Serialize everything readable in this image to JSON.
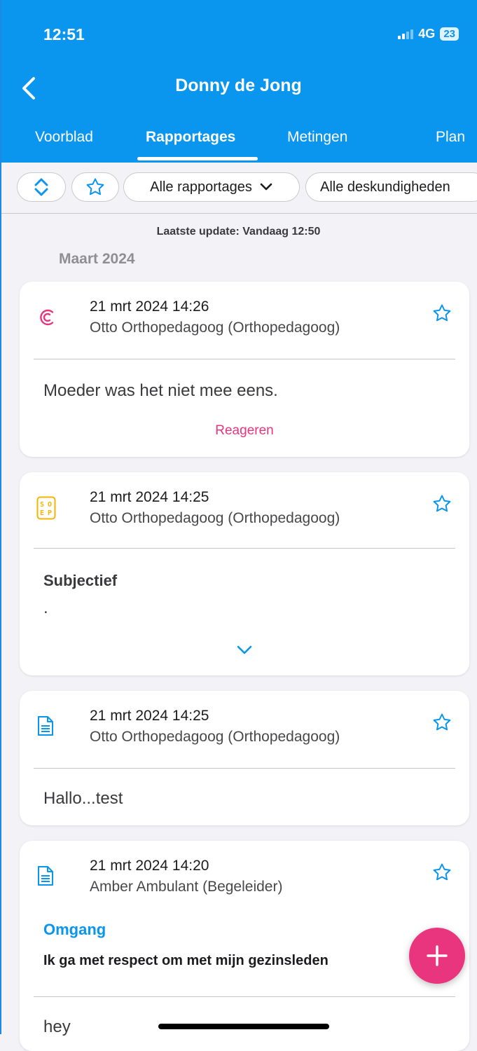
{
  "status": {
    "time": "12:51",
    "network": "4G",
    "battery": "23"
  },
  "header": {
    "title": "Donny de Jong"
  },
  "tabs": [
    {
      "label": "Voorblad",
      "active": false
    },
    {
      "label": "Rapportages",
      "active": true
    },
    {
      "label": "Metingen",
      "active": false
    },
    {
      "label": "Plan",
      "active": false
    }
  ],
  "filters": {
    "type_filter": "Alle rapportages",
    "expertise_filter": "Alle deskundigheden"
  },
  "feed": {
    "last_update": "Laatste update: Vandaag 12:50",
    "month": "Maart 2024",
    "reports": [
      {
        "icon": "conversation-icon",
        "date": "21 mrt 2024 14:26",
        "author": "Otto Orthopedagoog (Orthopedagoog)",
        "body": "Moeder was het niet mee eens.",
        "action": "Reageren"
      },
      {
        "icon": "soep-icon",
        "icon_text": [
          "S",
          "O",
          "E",
          "P"
        ],
        "date": "21 mrt 2024 14:25",
        "author": "Otto Orthopedagoog (Orthopedagoog)",
        "section": "Subjectief",
        "body": "."
      },
      {
        "icon": "document-icon",
        "date": "21 mrt 2024 14:25",
        "author": "Otto Orthopedagoog (Orthopedagoog)",
        "body": "Hallo...test"
      },
      {
        "icon": "document-icon",
        "date": "21 mrt 2024 14:20",
        "author": "Amber Ambulant (Begeleider)",
        "category": "Omgang",
        "statement": "Ik ga met respect om met mijn gezinsleden",
        "body": "hey"
      }
    ]
  },
  "colors": {
    "primary": "#0a95ee",
    "accent": "#e8357d",
    "soep": "#f5b400",
    "background": "#f2f2f7"
  }
}
